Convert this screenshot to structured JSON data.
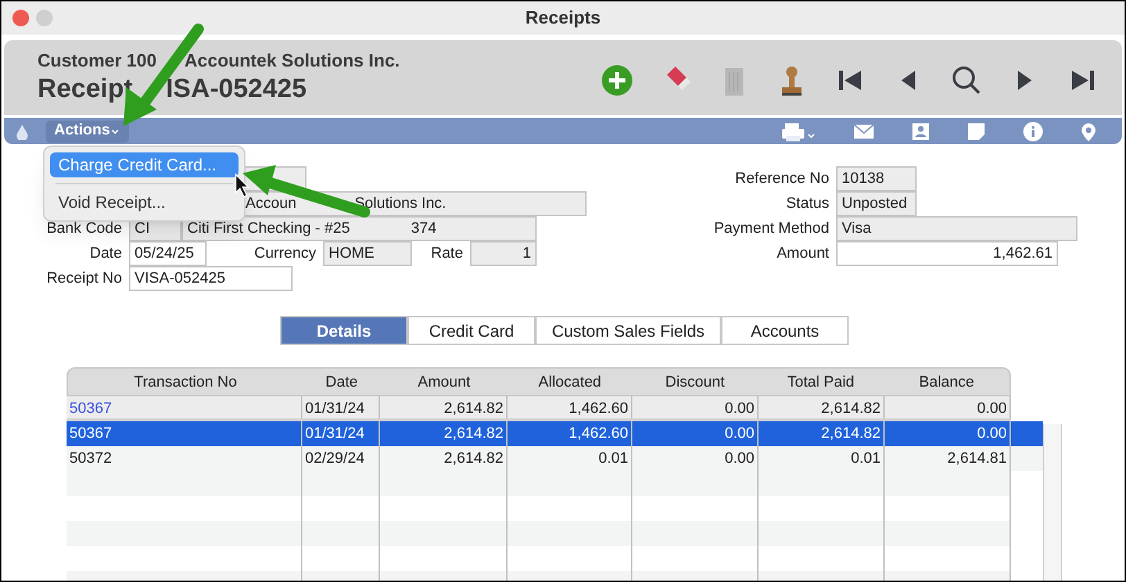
{
  "window": {
    "title": "Receipts"
  },
  "header": {
    "subtitle_parts": [
      "Customer 100",
      "Accountek Solutions Inc."
    ],
    "title_parts": [
      "Receipt",
      "ISA-052425"
    ]
  },
  "toolbar": [
    {
      "kind": "add"
    },
    {
      "kind": "erase"
    },
    {
      "kind": "trash",
      "disabled": true
    },
    {
      "kind": "stamp"
    },
    {
      "kind": "first"
    },
    {
      "kind": "prev"
    },
    {
      "kind": "search"
    },
    {
      "kind": "next"
    },
    {
      "kind": "last"
    }
  ],
  "action_bar": {
    "actions_label": "Actions",
    "icons": [
      {
        "kind": "print"
      },
      {
        "kind": "mail"
      },
      {
        "kind": "contact"
      },
      {
        "kind": "note"
      },
      {
        "kind": "info"
      },
      {
        "kind": "pin"
      }
    ]
  },
  "menu": {
    "items": [
      {
        "label": "Charge Credit Card...",
        "selected": true
      },
      {
        "label": "Void Receipt...",
        "selected": false
      }
    ]
  },
  "form": {
    "customer_name_parts": [
      "Accoun",
      "Solutions Inc."
    ],
    "bank_code_label": "Bank Code",
    "bank_code": "CI",
    "bank_name_parts": [
      "Citi First Checking - #25",
      "374"
    ],
    "date_label": "Date",
    "date": "05/24/25",
    "currency_label": "Currency",
    "currency": "HOME",
    "rate_label": "Rate",
    "rate": "1",
    "receipt_no_label": "Receipt No",
    "receipt_no": "VISA-052425",
    "right": [
      {
        "label": "Reference No",
        "value": "10138",
        "kind": "short"
      },
      {
        "label": "Status",
        "value": "Unposted",
        "kind": "short"
      },
      {
        "label": "Payment Method",
        "value": "Visa",
        "kind": "long"
      },
      {
        "label": "Amount",
        "value": "1,462.61",
        "kind": "amount"
      }
    ]
  },
  "tabs": [
    {
      "label": "Details",
      "selected": true
    },
    {
      "label": "Credit Card",
      "selected": false
    },
    {
      "label": "Custom Sales Fields",
      "selected": false
    },
    {
      "label": "Accounts",
      "selected": false
    }
  ],
  "table": {
    "columns": [
      "Transaction No",
      "Date",
      "Amount",
      "Allocated",
      "Discount",
      "Total Paid",
      "Balance"
    ],
    "rows": [
      {
        "kind": "summary",
        "selected": false,
        "cells": [
          "50367",
          "01/31/24",
          "2,614.82",
          "1,462.60",
          "0.00",
          "2,614.82",
          "0.00"
        ]
      },
      {
        "kind": "line",
        "selected": true,
        "cells": [
          "50367",
          "01/31/24",
          "2,614.82",
          "1,462.60",
          "0.00",
          "2,614.82",
          "0.00"
        ]
      },
      {
        "kind": "line",
        "selected": false,
        "cells": [
          "50372",
          "02/29/24",
          "2,614.82",
          "0.01",
          "0.00",
          "0.01",
          "2,614.81"
        ]
      }
    ]
  },
  "annotations": [
    {
      "kind": "arrow"
    },
    {
      "kind": "arrow"
    }
  ]
}
